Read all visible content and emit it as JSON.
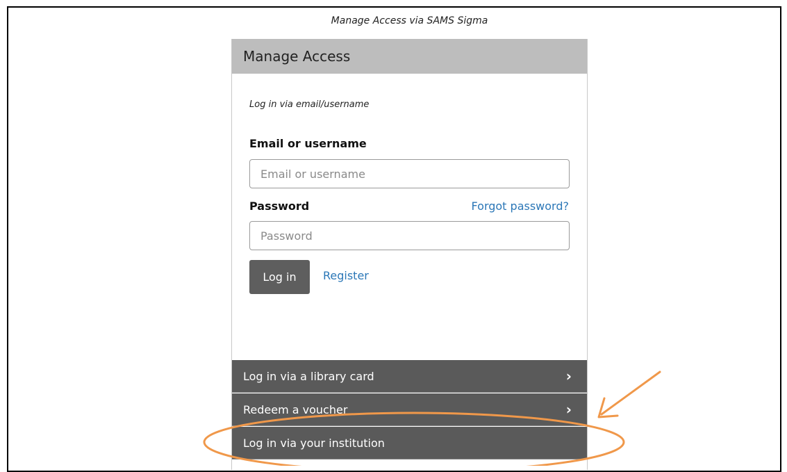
{
  "caption": "Manage Access via SAMS Sigma",
  "panel": {
    "title": "Manage Access",
    "login_mode": "Log in via email/username",
    "email_label": "Email or username",
    "email_placeholder": "Email or username",
    "password_label": "Password",
    "forgot_link": "Forgot password?",
    "password_placeholder": "Password",
    "login_button": "Log in",
    "register_link": "Register"
  },
  "options": [
    {
      "label": "Log in via a library card",
      "chevron": "›"
    },
    {
      "label": "Redeem a voucher",
      "chevron": "›"
    },
    {
      "label": "Log in via your institution"
    }
  ],
  "colors": {
    "header_bg": "#bdbdbd",
    "option_bg": "#5a5a5a",
    "link": "#2b77b7",
    "annotation": "#f0984a"
  }
}
